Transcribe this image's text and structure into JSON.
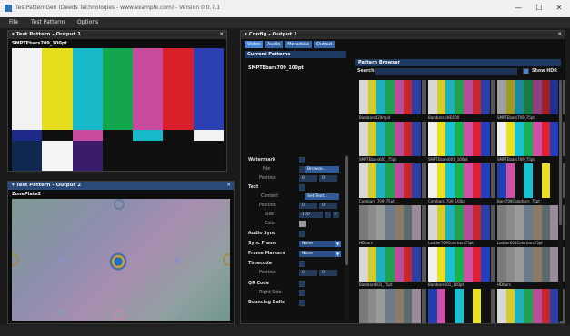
{
  "window": {
    "title": "TestPatternGen (Deeds Technologies - www.example.com) - Version 0.0.7.1",
    "minimize_glyph": "—",
    "maximize_glyph": "☐",
    "close_glyph": "✕"
  },
  "menu": {
    "items": [
      "File",
      "Test Patterns",
      "Options"
    ]
  },
  "panel1": {
    "title": "Test Pattern - Output 1",
    "caption": "SMPTEbars709_100pt",
    "bars_top": [
      "#f2f2f2",
      "#e6de1c",
      "#17b8c8",
      "#14a64c",
      "#c94b9e",
      "#d9202a",
      "#2a3fb0"
    ],
    "bars_mid": [
      "#1e2a8a",
      "#101010",
      "#c94b9e",
      "#101010",
      "#17b8c8",
      "#101010",
      "#f2f2f2"
    ],
    "bars_bottom": [
      "#0f2850",
      "#f5f5f5",
      "#3a1a6a",
      "#101010",
      "#101010",
      "#101010",
      "#101010"
    ]
  },
  "panel2": {
    "title": "Test Pattern - Output 2",
    "caption": "ZonePlate2"
  },
  "config": {
    "title": "Config - Output 1",
    "tabs": [
      "Video",
      "Audio",
      "Metadata",
      "Output"
    ],
    "current_patterns_header": "Current Patterns",
    "current_pattern_name": "SMPTEbars709_100pt",
    "labels": {
      "watermark": "Watermark",
      "file": "File",
      "browse": "Browse...",
      "position": "Position",
      "text": "Text",
      "content": "Content",
      "set_text": "Set Text...",
      "size": "Size",
      "size_value": "100",
      "color": "Color",
      "audio_sync": "Audio Sync",
      "sync_frame": "Sync Frame",
      "frame_markers": "Frame Markers",
      "timecode": "Timecode",
      "qr_code": "QR Code",
      "right_side": "Right Side",
      "bouncing_balls": "Bouncing Balls",
      "none": "None",
      "zero": "0",
      "minus": "-",
      "plus": "+"
    }
  },
  "browser": {
    "header": "Pattern Browser",
    "search_label": "Search",
    "show_hdr_label": "Show HDR",
    "thumbnails": [
      {
        "label": "Barsbars420mp4",
        "palette": "smpte"
      },
      {
        "label": "BarsbarsUHD100",
        "palette": "smpte"
      },
      {
        "label": "SMPTEbars709_75pt",
        "palette": "smpte_dark"
      },
      {
        "label": "SMPTEbars601_75pt",
        "palette": "smpte"
      },
      {
        "label": "SMPTEbars601_100pt",
        "palette": "smpte_bright"
      },
      {
        "label": "SMPTEbars709_75pt",
        "palette": "smpte_bright"
      },
      {
        "label": "Combars_709_75pt",
        "palette": "smpte"
      },
      {
        "label": "Combars_709_100pt",
        "palette": "smpte_bright"
      },
      {
        "label": "Bars709Colorbars_75pt",
        "palette": "squares"
      },
      {
        "label": "HDbars",
        "palette": "muted"
      },
      {
        "label": "Ladder709Colorbars75pt",
        "palette": "smpte"
      },
      {
        "label": "Ladder601Colorbars75pt",
        "palette": "muted"
      },
      {
        "label": "Barsbars601_75pt",
        "palette": "smpte"
      },
      {
        "label": "Barsbars601_100pt",
        "palette": "smpte_bright"
      },
      {
        "label": "HDbars",
        "palette": "muted"
      },
      {
        "label": "",
        "palette": "muted"
      },
      {
        "label": "",
        "palette": "squares"
      },
      {
        "label": "",
        "palette": "smpte"
      }
    ]
  },
  "colors": {
    "accent": "#294a7a",
    "tab": "#3466a8",
    "panel_bg": "#0d0d0d"
  }
}
